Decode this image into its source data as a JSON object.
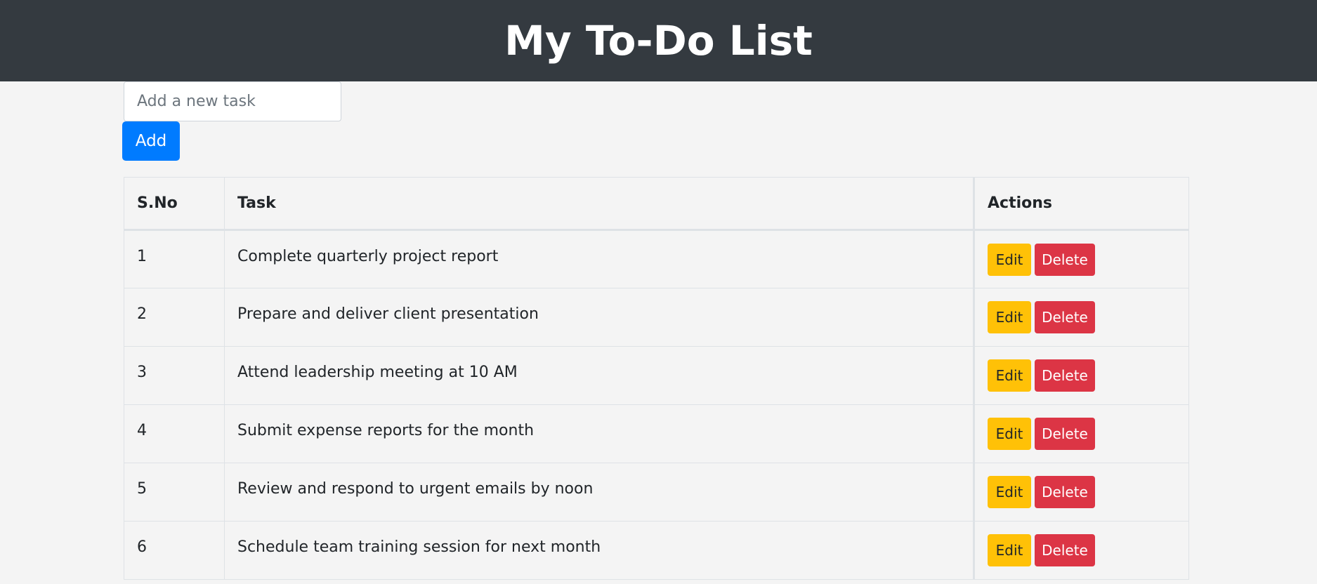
{
  "header": {
    "title": "My To-Do List"
  },
  "form": {
    "placeholder": "Add a new task",
    "value": "",
    "add_label": "Add"
  },
  "table": {
    "headers": [
      "S.No",
      "Task",
      "Actions"
    ],
    "edit_label": "Edit",
    "delete_label": "Delete",
    "rows": [
      {
        "sno": "1",
        "task": "Complete quarterly project report"
      },
      {
        "sno": "2",
        "task": "Prepare and deliver client presentation"
      },
      {
        "sno": "3",
        "task": "Attend leadership meeting at 10 AM"
      },
      {
        "sno": "4",
        "task": "Submit expense reports for the month"
      },
      {
        "sno": "5",
        "task": "Review and respond to urgent emails by noon"
      },
      {
        "sno": "6",
        "task": "Schedule team training session for next month"
      }
    ]
  },
  "colors": {
    "header_bg": "#343a40",
    "page_bg": "#f4f4f4",
    "primary": "#007bff",
    "warning": "#ffc107",
    "danger": "#dc3545"
  }
}
